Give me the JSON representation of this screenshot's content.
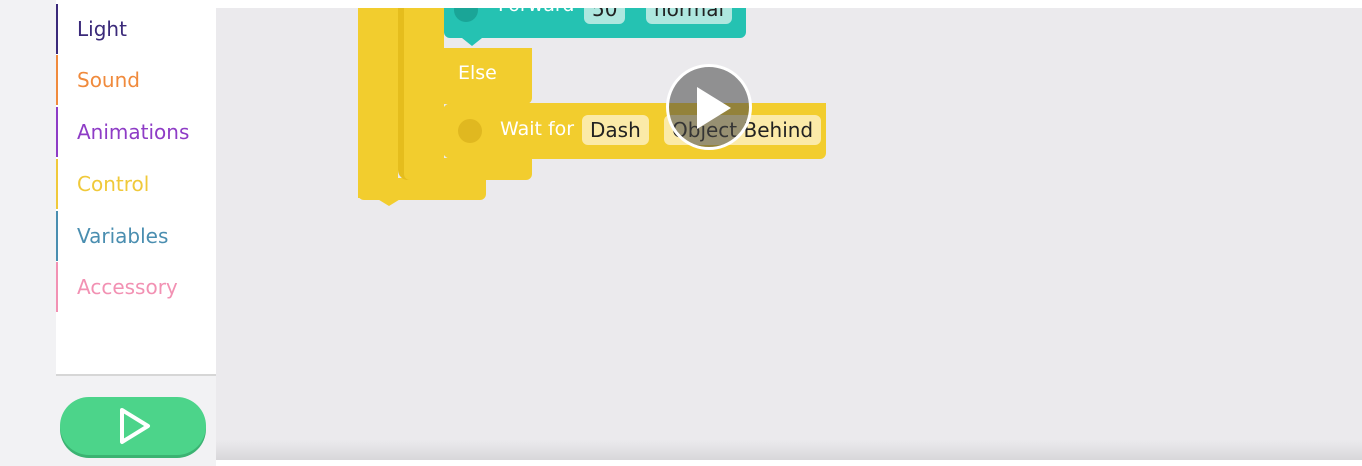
{
  "sidebar": {
    "categories": [
      {
        "label": "Light",
        "color": "#3b2a7a"
      },
      {
        "label": "Sound",
        "color": "#f08a3c"
      },
      {
        "label": "Animations",
        "color": "#8e3cc6"
      },
      {
        "label": "Control",
        "color": "#f0c93a"
      },
      {
        "label": "Variables",
        "color": "#4a8eb0"
      },
      {
        "label": "Accessory",
        "color": "#f291b3"
      }
    ],
    "run_button_icon": "play-icon"
  },
  "canvas": {
    "forward_block": {
      "label": "Forward",
      "distance": "50",
      "speed": "normal"
    },
    "else_label": "Else",
    "wait_block": {
      "label": "Wait for",
      "target": "Dash",
      "condition": "Object Behind"
    }
  },
  "video_overlay": {
    "icon": "play-icon"
  },
  "colors": {
    "control_yellow": "#f2cd2e",
    "drive_teal": "#25c2b2",
    "run_green": "#4cd48a"
  }
}
